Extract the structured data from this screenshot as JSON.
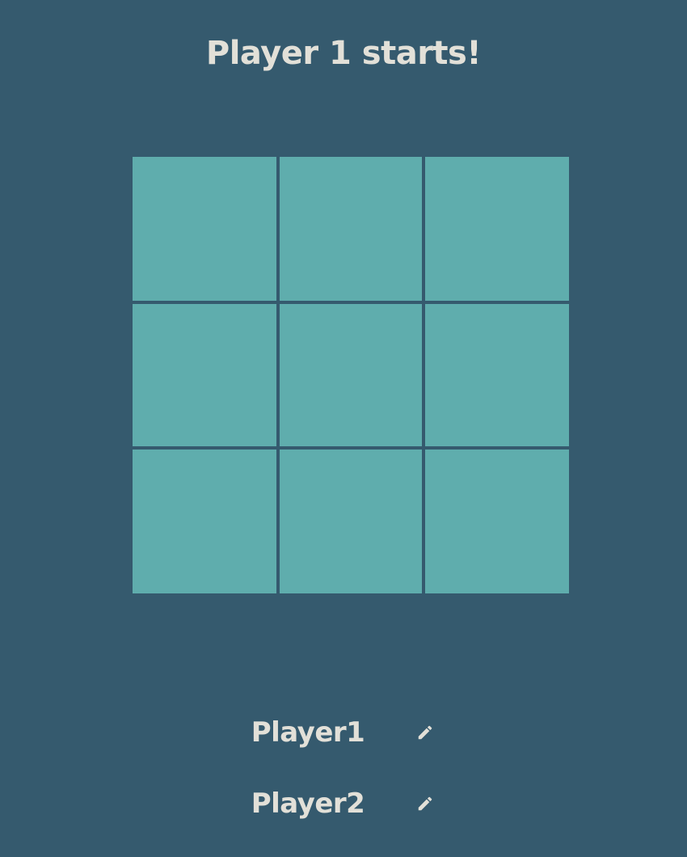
{
  "status": {
    "text": "Player 1 starts!"
  },
  "board": {
    "cells": [
      "",
      "",
      "",
      "",
      "",
      "",
      "",
      "",
      ""
    ]
  },
  "players": [
    {
      "name": "Player1",
      "edit_icon": "pencil-icon"
    },
    {
      "name": "Player2",
      "edit_icon": "pencil-icon"
    }
  ],
  "colors": {
    "background": "#355a6e",
    "cell": "#5fadad",
    "text": "#e2e0d8"
  }
}
